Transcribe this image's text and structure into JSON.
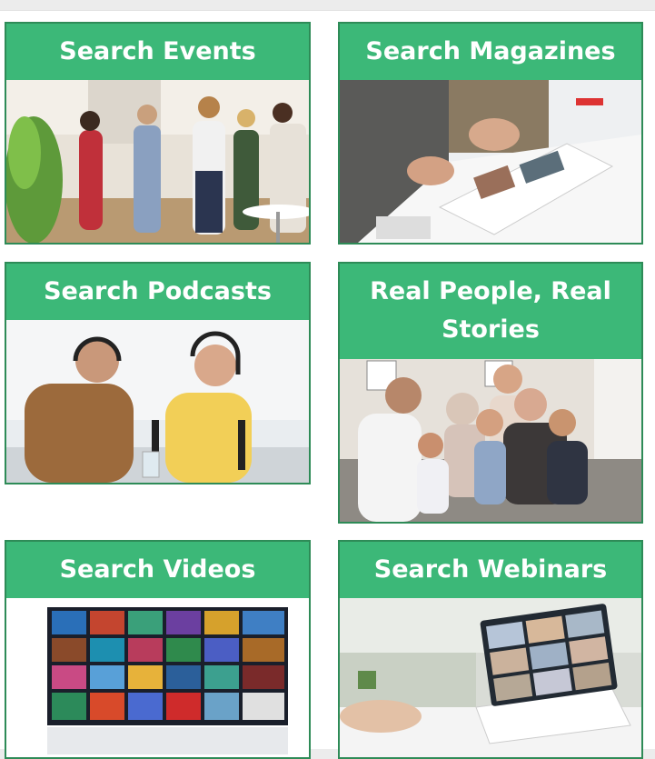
{
  "cards": [
    {
      "title": "Search Events",
      "image": "networking-event-photo"
    },
    {
      "title": "Search Magazines",
      "image": "magazine-reading-photo"
    },
    {
      "title": "Search Podcasts",
      "image": "podcast-recording-photo"
    },
    {
      "title": "Real People, Real Stories",
      "image": "family-photo"
    },
    {
      "title": "Search Videos",
      "image": "video-wall-photo"
    },
    {
      "title": "Search Webinars",
      "image": "video-conference-laptop-photo"
    }
  ],
  "colors": {
    "accent": "#3cb878",
    "border": "#2e8b57",
    "text": "#ffffff"
  }
}
